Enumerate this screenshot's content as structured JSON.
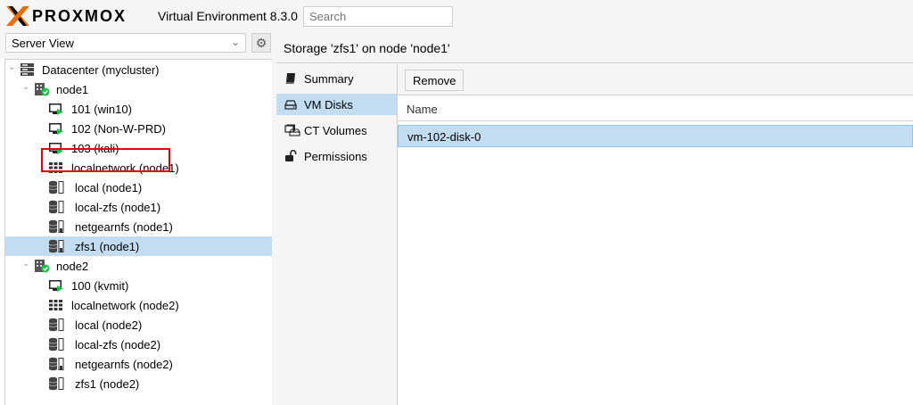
{
  "header": {
    "brand": "PROXMOX",
    "version_label": "Virtual Environment 8.3.0",
    "search_placeholder": "Search"
  },
  "colors": {
    "brand_orange": "#e57000",
    "selection": "#c2ddf2",
    "status_green": "#21bf4b",
    "highlight_red": "#e00000"
  },
  "left": {
    "view_select": "Server View",
    "tree": [
      {
        "label": "Datacenter (mycluster)",
        "icon": "datacenter-icon",
        "depth": 0,
        "expanded": true
      },
      {
        "label": "node1",
        "icon": "node-online-icon",
        "depth": 1,
        "expanded": true
      },
      {
        "label": "101 (win10)",
        "icon": "vm-running-icon",
        "depth": 2
      },
      {
        "label": "102 (Non-W-PRD)",
        "icon": "vm-stopped-icon",
        "depth": 2,
        "highlighted": true
      },
      {
        "label": "103 (kali)",
        "icon": "vm-running-icon",
        "depth": 2
      },
      {
        "label": "localnetwork (node1)",
        "icon": "sdn-grid-icon",
        "depth": 2
      },
      {
        "label": "local (node1)",
        "icon": "storage-icon",
        "depth": 2
      },
      {
        "label": "local-zfs (node1)",
        "icon": "storage-icon",
        "depth": 2
      },
      {
        "label": "netgearnfs (node1)",
        "icon": "storage-icon",
        "depth": 2
      },
      {
        "label": "zfs1 (node1)",
        "icon": "storage-icon",
        "depth": 2,
        "selected": true
      },
      {
        "label": "node2",
        "icon": "node-online-icon",
        "depth": 1,
        "expanded": true
      },
      {
        "label": "100 (kvmit)",
        "icon": "vm-running-icon",
        "depth": 2
      },
      {
        "label": "localnetwork (node2)",
        "icon": "sdn-grid-icon",
        "depth": 2
      },
      {
        "label": "local (node2)",
        "icon": "storage-icon",
        "depth": 2
      },
      {
        "label": "local-zfs (node2)",
        "icon": "storage-icon",
        "depth": 2
      },
      {
        "label": "netgearnfs (node2)",
        "icon": "storage-icon",
        "depth": 2
      },
      {
        "label": "zfs1 (node2)",
        "icon": "storage-icon",
        "depth": 2
      }
    ]
  },
  "right": {
    "title": "Storage 'zfs1' on node 'node1'",
    "nav": [
      {
        "label": "Summary",
        "icon": "book-icon"
      },
      {
        "label": "VM Disks",
        "icon": "hdd-icon",
        "selected": true
      },
      {
        "label": "CT Volumes",
        "icon": "ct-volumes-icon"
      },
      {
        "label": "Permissions",
        "icon": "unlock-icon"
      }
    ],
    "toolbar": {
      "remove_label": "Remove"
    },
    "grid": {
      "column_name": "Name",
      "rows": [
        "vm-102-disk-0"
      ]
    }
  }
}
